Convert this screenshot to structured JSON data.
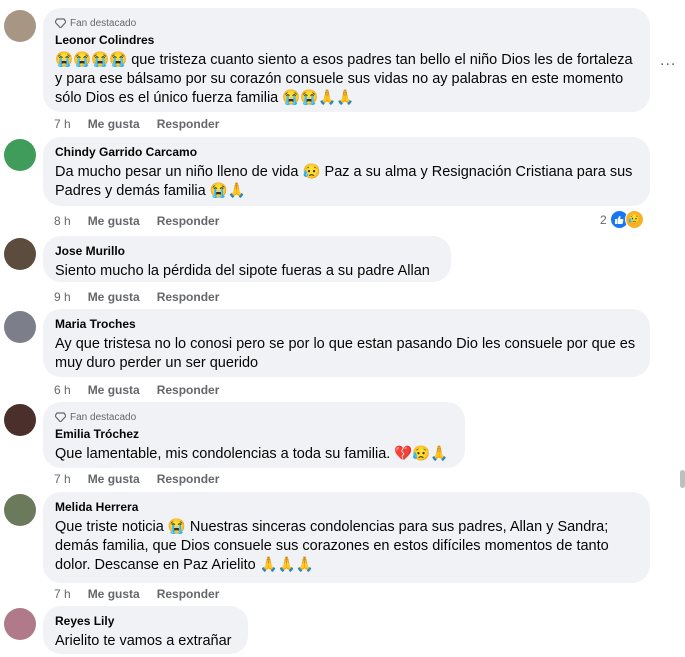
{
  "badge_text": "Fan destacado",
  "more_label": "...",
  "like_label": "Me gusta",
  "reply_label": "Responder",
  "comments": [
    {
      "author": "Leonor Colindres",
      "text": "😭😭😭😭 que tristeza cuanto siento a esos padres tan bello el niño Dios les de fortaleza y para ese bálsamo por su corazón consuele sus vidas no ay palabras en este momento sólo Dios es el único fuerza familia 😭😭🙏🙏",
      "time": "7 h"
    },
    {
      "author": "Chindy Garrido Carcamo",
      "text": "Da mucho pesar un niño lleno de vida 😥 Paz a su alma y Resignación Cristiana para sus Padres y demás familia 😭🙏",
      "time": "8 h",
      "reaction_count": "2"
    },
    {
      "author": "Jose Murillo",
      "text": "Siento mucho la pérdida del sipote fueras a su padre Allan",
      "time": "9 h"
    },
    {
      "author": "Maria Troches",
      "text": "Ay que tristesa no lo conosi pero se por lo que estan pasando Dio les consuele por que es muy duro perder un ser querido",
      "time": "6 h"
    },
    {
      "author": "Emilia Tróchez",
      "text": "Que lamentable, mis condolencias a toda su familia. 💔😥🙏",
      "time": "7 h"
    },
    {
      "author": "Melida Herrera",
      "text": "Que triste noticia 😭 Nuestras sinceras condolencias para sus padres, Allan y Sandra; demás familia, que Dios consuele sus corazones en estos difíciles momentos de tanto dolor. Descanse en Paz Arielito 🙏🙏🙏",
      "time": "7 h"
    },
    {
      "author": "Reyes Lily",
      "text": "Arielito te vamos a extrañar"
    }
  ],
  "colors": {
    "bubble": "#f0f2f5",
    "meta_text": "#65676b",
    "like_blue": "#1877f2",
    "sad_yellow": "#f7b125"
  }
}
